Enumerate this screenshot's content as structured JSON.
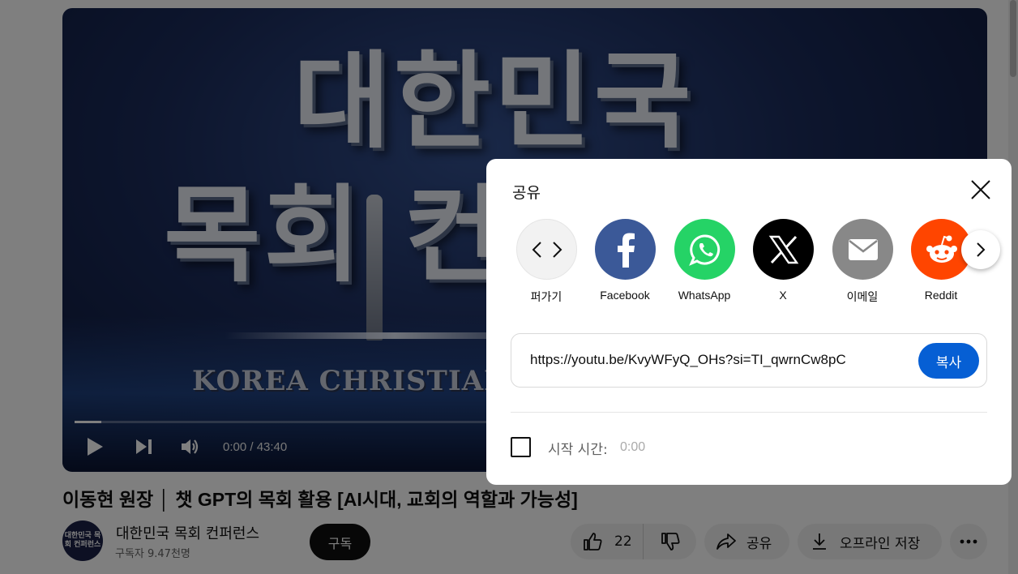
{
  "player": {
    "art_line1": "대한민국",
    "art_line2": "목회 컨",
    "art_sub": "KOREA CHRISTIAN",
    "time": "0:00 / 43:40",
    "progress_fraction": 0.03
  },
  "video": {
    "title": "이동현 원장 │ 챗 GPT의 목회 활용 [AI시대, 교회의 역할과 가능성]",
    "channel_avatar_text": "대한민국 목회 컨퍼런스",
    "channel_name": "대한민국 목회 컨퍼런스",
    "subscribers": "구독자 9.47천명",
    "subscribe_label": "구독",
    "like_count": "22",
    "share_label": "공유",
    "offline_label": "오프라인 저장"
  },
  "share_dialog": {
    "title": "공유",
    "targets": [
      {
        "label": "퍼가기",
        "icon": "embed-icon",
        "color": "#f2f2f2"
      },
      {
        "label": "Facebook",
        "icon": "facebook-icon",
        "color": "#3b5998"
      },
      {
        "label": "WhatsApp",
        "icon": "whatsapp-icon",
        "color": "#25d366"
      },
      {
        "label": "X",
        "icon": "x-icon",
        "color": "#000000"
      },
      {
        "label": "이메일",
        "icon": "email-icon",
        "color": "#888888"
      },
      {
        "label": "Reddit",
        "icon": "reddit-icon",
        "color": "#ff4500"
      }
    ],
    "url": "https://youtu.be/KvyWFyQ_OHs?si=TI_qwrnCw8pC",
    "copy_label": "복사",
    "start_time_label": "시작 시간:",
    "start_time_value": "0:00"
  },
  "colors": {
    "accent": "#065fd4",
    "overlay": "rgba(0,0,0,0.5)"
  }
}
